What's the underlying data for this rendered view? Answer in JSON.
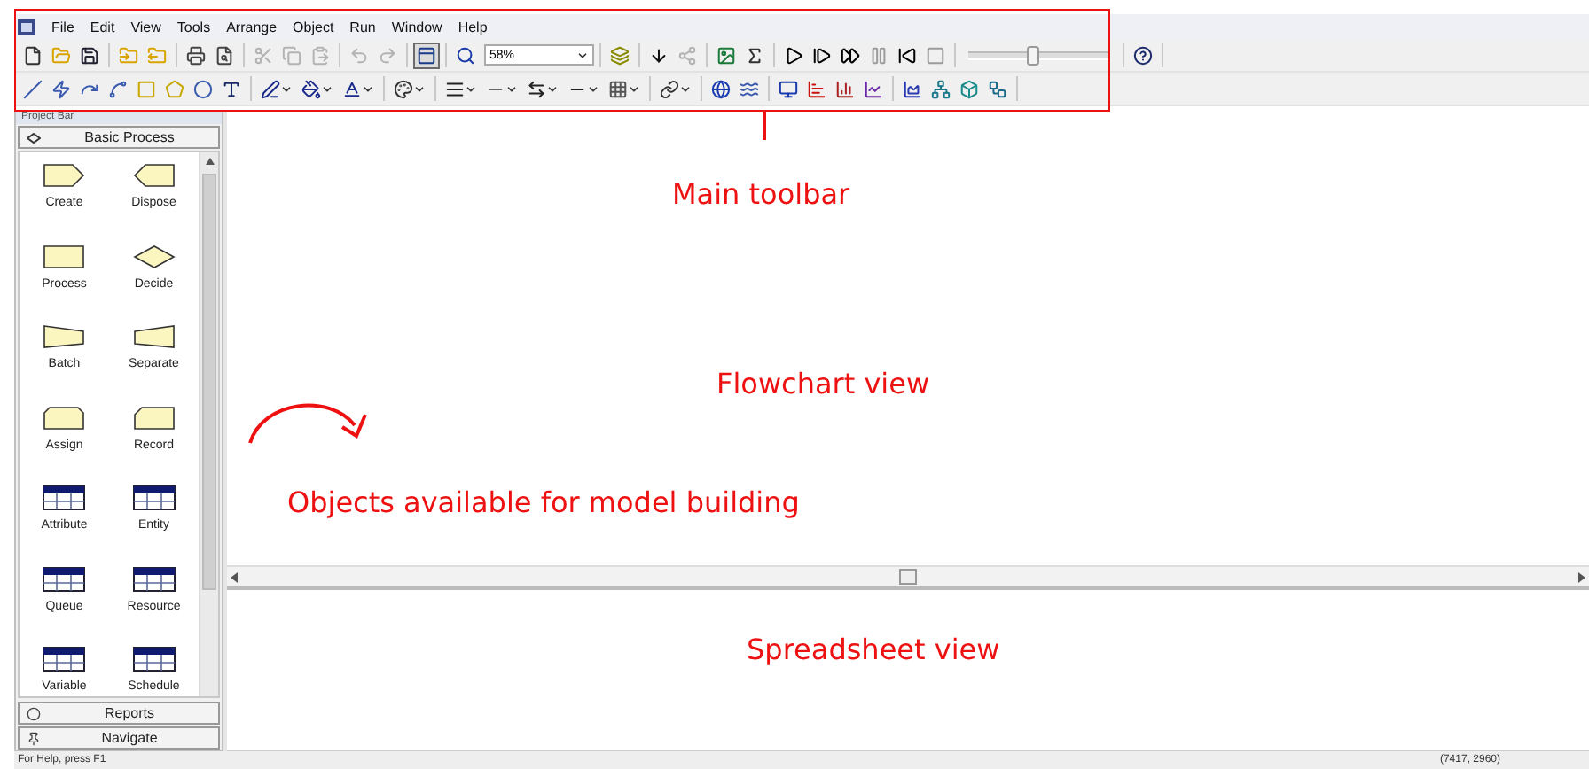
{
  "menu": [
    "File",
    "Edit",
    "View",
    "Tools",
    "Arrange",
    "Object",
    "Run",
    "Window",
    "Help"
  ],
  "toolbars": [
    [
      [
        {
          "kind": "new",
          "disabled": false
        },
        {
          "kind": "open",
          "disabled": false
        },
        {
          "kind": "save",
          "disabled": false
        }
      ],
      [
        {
          "kind": "template-open",
          "disabled": false
        },
        {
          "kind": "template-save",
          "disabled": false
        }
      ],
      [
        {
          "kind": "print",
          "disabled": false
        },
        {
          "kind": "preview",
          "disabled": false
        }
      ],
      [
        {
          "kind": "cut",
          "disabled": true
        },
        {
          "kind": "copy",
          "disabled": true
        },
        {
          "kind": "paste",
          "disabled": true
        }
      ],
      [
        {
          "kind": "undo",
          "disabled": true
        },
        {
          "kind": "redo",
          "disabled": true
        }
      ],
      [
        {
          "kind": "layout",
          "disabled": false,
          "pressed": true
        }
      ],
      [
        {
          "kind": "zoom",
          "disabled": false,
          "value": "58%"
        }
      ],
      [
        {
          "kind": "layers",
          "disabled": false
        }
      ],
      [
        {
          "kind": "drop",
          "disabled": false
        },
        {
          "kind": "connect",
          "disabled": true
        }
      ],
      [
        {
          "kind": "picture",
          "disabled": false
        },
        {
          "kind": "sigma",
          "disabled": false
        }
      ],
      [
        {
          "kind": "play",
          "disabled": false
        },
        {
          "kind": "step",
          "disabled": false
        },
        {
          "kind": "fast",
          "disabled": false
        },
        {
          "kind": "pause",
          "disabled": true
        },
        {
          "kind": "start",
          "disabled": false
        },
        {
          "kind": "stop",
          "disabled": true
        }
      ],
      [
        {
          "kind": "slider",
          "level": 0.45
        }
      ],
      [
        {
          "kind": "help",
          "disabled": false
        }
      ]
    ],
    [
      [
        {
          "kind": "line",
          "disabled": false
        },
        {
          "kind": "polyline",
          "disabled": false
        },
        {
          "kind": "arc",
          "disabled": false
        },
        {
          "kind": "curve",
          "disabled": false
        },
        {
          "kind": "rectangle",
          "disabled": false
        },
        {
          "kind": "polygon",
          "disabled": false
        },
        {
          "kind": "ellipse",
          "disabled": false
        },
        {
          "kind": "text",
          "disabled": false
        }
      ],
      [
        {
          "kind": "line-color",
          "disabled": false
        },
        {
          "kind": "fill-color",
          "disabled": false
        },
        {
          "kind": "text-color",
          "disabled": false
        }
      ],
      [
        {
          "kind": "palette",
          "disabled": false
        }
      ],
      [
        {
          "kind": "line-width",
          "disabled": false
        },
        {
          "kind": "line-style",
          "disabled": false
        },
        {
          "kind": "arrow-style",
          "disabled": false
        },
        {
          "kind": "dash",
          "disabled": false
        },
        {
          "kind": "pattern",
          "disabled": false
        }
      ],
      [
        {
          "kind": "link",
          "disabled": false
        }
      ],
      [
        {
          "kind": "globe",
          "disabled": false
        },
        {
          "kind": "waves",
          "disabled": false
        }
      ],
      [
        {
          "kind": "monitor",
          "disabled": false
        },
        {
          "kind": "bar-chart",
          "disabled": false
        },
        {
          "kind": "column-chart",
          "disabled": false
        },
        {
          "kind": "line-chart",
          "disabled": false
        }
      ],
      [
        {
          "kind": "histogram",
          "disabled": false
        },
        {
          "kind": "network",
          "disabled": false
        },
        {
          "kind": "box",
          "disabled": false
        },
        {
          "kind": "workflow",
          "disabled": false
        }
      ]
    ]
  ],
  "project_bar": {
    "title": "Project Bar",
    "panel": "Basic Process",
    "modules": [
      {
        "label": "Create",
        "kind": "create"
      },
      {
        "label": "Dispose",
        "kind": "dispose"
      },
      {
        "label": "Process",
        "kind": "process"
      },
      {
        "label": "Decide",
        "kind": "decide"
      },
      {
        "label": "Batch",
        "kind": "batch"
      },
      {
        "label": "Separate",
        "kind": "separate"
      },
      {
        "label": "Assign",
        "kind": "assign"
      },
      {
        "label": "Record",
        "kind": "record"
      },
      {
        "label": "Attribute",
        "kind": "table"
      },
      {
        "label": "Entity",
        "kind": "table"
      },
      {
        "label": "Queue",
        "kind": "table"
      },
      {
        "label": "Resource",
        "kind": "table"
      },
      {
        "label": "Variable",
        "kind": "table"
      },
      {
        "label": "Schedule",
        "kind": "table"
      }
    ],
    "sections": [
      {
        "label": "Reports",
        "kind": "reports"
      },
      {
        "label": "Navigate",
        "kind": "navigate"
      }
    ]
  },
  "annotations": {
    "toolbar": "Main toolbar",
    "flowchart": "Flowchart view",
    "objects": "Objects available for model building",
    "spreadsheet": "Spreadsheet view"
  },
  "status_bar": {
    "help": "For Help, press F1",
    "coordinates": "(7417, 2960)"
  }
}
